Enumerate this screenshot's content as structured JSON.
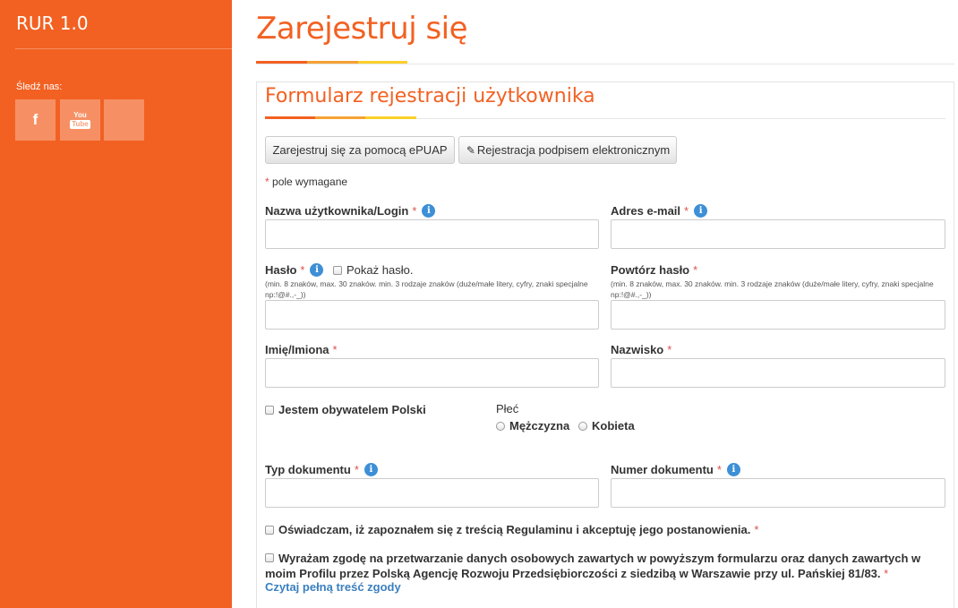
{
  "sidebar": {
    "brand": "RUR 1.0",
    "follow_label": "Śledź nas:",
    "social": [
      {
        "name": "facebook",
        "glyph": "f"
      },
      {
        "name": "youtube",
        "top": "You",
        "bottom": "Tube"
      },
      {
        "name": "empty",
        "glyph": ""
      }
    ]
  },
  "page": {
    "title": "Zarejestruj się"
  },
  "form": {
    "title": "Formularz rejestracji użytkownika",
    "buttons": {
      "epuap": "Zarejestruj się za pomocą ePUAP",
      "signature": "Rejestracja podpisem elektronicznym"
    },
    "required_note_star": "*",
    "required_note": "pole wymagane",
    "fields": {
      "login": {
        "label": "Nazwa użytkownika/Login",
        "star": "*",
        "value": ""
      },
      "email": {
        "label": "Adres e-mail",
        "star": "*",
        "value": ""
      },
      "password": {
        "label": "Hasło",
        "star": "*",
        "value": "",
        "hint": "(min. 8 znaków, max. 30 znaków. min. 3 rodzaje znaków (duże/małe litery, cyfry, znaki specjalne np:!@#.,-_))"
      },
      "show_password": {
        "label": "Pokaż hasło.",
        "checked": false
      },
      "password_repeat": {
        "label": "Powtórz hasło",
        "star": "*",
        "value": "",
        "hint": "(min. 8 znaków, max. 30 znaków. min. 3 rodzaje znaków (duże/małe litery, cyfry, znaki specjalne np:!@#.,-_))"
      },
      "first_name": {
        "label": "Imię/Imiona",
        "star": "*",
        "value": ""
      },
      "last_name": {
        "label": "Nazwisko",
        "star": "*",
        "value": ""
      },
      "polish_citizen": {
        "label": "Jestem obywatelem Polski",
        "checked": false
      },
      "gender": {
        "label": "Płeć",
        "options": [
          "Mężczyzna",
          "Kobieta"
        ],
        "selected": null
      },
      "doc_type": {
        "label": "Typ dokumentu",
        "star": "*",
        "value": ""
      },
      "doc_number": {
        "label": "Numer dokumentu",
        "star": "*",
        "value": ""
      }
    },
    "terms": {
      "text": "Oświadczam, iż zapoznałem się z treścią Regulaminu i akceptuję jego postanowienia.",
      "star": "*",
      "checked": false
    },
    "consent": {
      "text": "Wyrażam zgodę na przetwarzanie danych osobowych zawartych w powyższym formularzu oraz danych zawartych w moim Profilu przez Polską Agencję Rozwoju Przedsiębiorczości z siedzibą w Warszawie przy ul. Pańskiej 81/83.",
      "star": "*",
      "link": "Czytaj pełną treść zgody",
      "checked": false
    },
    "info_icon_glyph": "i"
  },
  "colors": {
    "brand_orange": "#f26122",
    "accent_amber": "#f5a233",
    "accent_yellow": "#fcd02a",
    "info_blue": "#3d8fd6",
    "required_red": "#d9534f"
  }
}
